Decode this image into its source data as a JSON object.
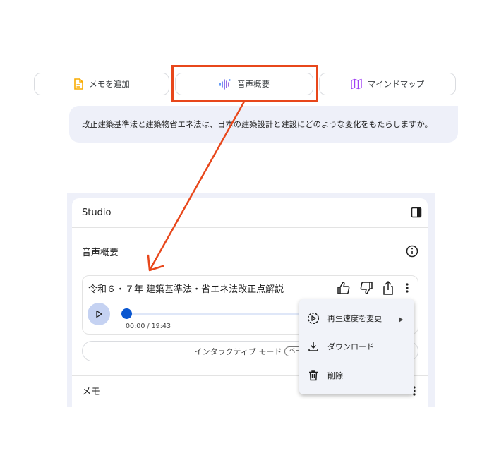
{
  "chips": {
    "memo": {
      "label": "メモを追加",
      "icon": "note-icon"
    },
    "audio": {
      "label": "音声概要",
      "icon": "audio-waveform-icon"
    },
    "mindmap": {
      "label": "マインドマップ",
      "icon": "map-icon"
    }
  },
  "prompt": {
    "text": "改正建築基準法と建築物省エネ法は、日本の建築設計と建設にどのような変化をもたらしますか。"
  },
  "studio": {
    "title": "Studio",
    "audio_section": {
      "title": "音声概要",
      "track": {
        "title": "令和６・７年 建築基準法・省エネ法改正点解説",
        "time": "00:00 / 19:43",
        "progress": 0
      },
      "interactive_label": "インタラクティブ モード",
      "interactive_badge": "ベー"
    },
    "memo_section": {
      "title": "メモ"
    }
  },
  "menu": {
    "items": [
      {
        "label": "再生速度を変更",
        "icon": "playback-speed-icon"
      },
      {
        "label": "ダウンロード",
        "icon": "download-icon"
      },
      {
        "label": "削除",
        "icon": "trash-icon"
      }
    ]
  },
  "colors": {
    "highlight": "#e8471b",
    "accent": "#0b57d0",
    "panel_bg": "#eef0f9"
  }
}
